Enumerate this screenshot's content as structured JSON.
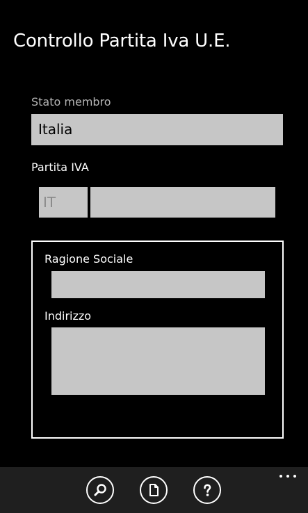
{
  "header": {
    "title": "Controllo Partita Iva U.E."
  },
  "form": {
    "member_state_label": "Stato membro",
    "member_state_value": "Italia",
    "vat_label": "Partita IVA",
    "vat_country_prefix": "IT",
    "vat_number_value": ""
  },
  "result": {
    "company_name_label": "Ragione Sociale",
    "company_name_value": "",
    "address_label": "Indirizzo",
    "address_value": ""
  },
  "app_bar": {
    "buttons": [
      {
        "icon": "search-icon"
      },
      {
        "icon": "document-icon"
      },
      {
        "icon": "help-icon"
      }
    ],
    "more_icon": "ellipsis-icon"
  },
  "colors": {
    "background": "#000000",
    "field_fill": "#c6c6c6",
    "app_bar": "#1f1f1f",
    "muted_label": "#b5b5b5"
  }
}
